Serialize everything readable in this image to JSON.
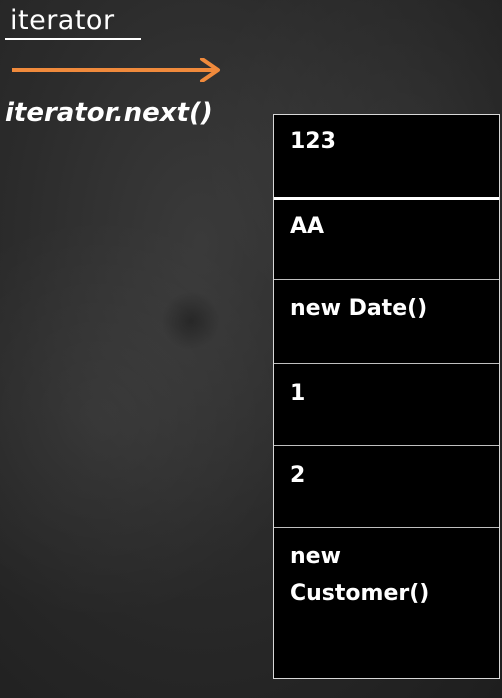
{
  "labels": {
    "iterator": "iterator",
    "next_call": "iterator.next()"
  },
  "colors": {
    "arrow": "#f08a3c",
    "board": "#2b2b2b",
    "cell_background": "#000000",
    "text": "#ffffff"
  },
  "collection": {
    "elements": [
      "123",
      "AA",
      "new Date()",
      "1",
      "2",
      "new\nCustomer()"
    ]
  }
}
